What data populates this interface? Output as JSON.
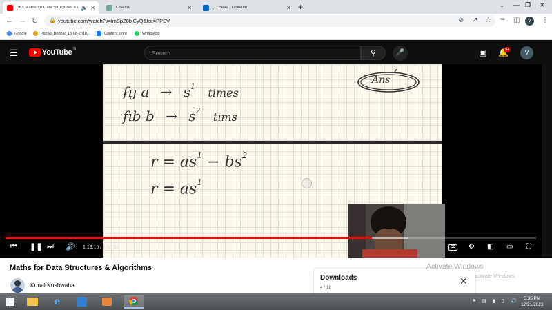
{
  "browser": {
    "tabs": [
      {
        "title": "(90) Maths for Data Structures & Algor",
        "favicon": "youtube-icon",
        "active": true
      },
      {
        "title": "ChatGPT",
        "favicon": "chatgpt-icon",
        "active": false
      },
      {
        "title": "(1) Feed | LinkedIn",
        "favicon": "linkedin-icon",
        "active": false
      }
    ],
    "url": "youtube.com/watch?v=lmSpZ0bjCyQ&list=PPSV",
    "bookmarks": [
      {
        "label": "Google",
        "icon": "google-icon"
      },
      {
        "label": "Patrika Bhopal, 13-08-2018...",
        "icon": "patrika-icon"
      },
      {
        "label": "Content store",
        "icon": "store-icon"
      },
      {
        "label": "WhatsApp",
        "icon": "whatsapp-icon"
      }
    ],
    "profile_initial": "V"
  },
  "youtube": {
    "logo_text": "YouTube",
    "country_code": "IN",
    "search_placeholder": "Search",
    "notification_count": "9+",
    "avatar_initial": "V"
  },
  "player": {
    "board_top": {
      "line1": {
        "lhs": "fıȷ a",
        "arrow": "→",
        "rhs": "s",
        "exp": "1",
        "suffix": "times"
      },
      "line2": {
        "lhs": "fıb b",
        "arrow": "→",
        "rhs": "s",
        "exp": "2",
        "suffix": "tıms"
      },
      "corner_note": "Ans"
    },
    "board_bottom": {
      "line1": {
        "text": "r = as",
        "exp1": "1",
        "mid": " − bs",
        "exp2": "2"
      },
      "line2": {
        "text": "r = as",
        "exp1": "1"
      }
    },
    "time_current": "1:19:15",
    "time_separator": " / ",
    "time_total": "1:54:53",
    "progress_fraction": 0.69,
    "buffered_fraction": 0.76,
    "accent_color": "#ff0000"
  },
  "video": {
    "title": "Maths for Data Structures & Algorithms",
    "channel": "Kunal Kushwaha"
  },
  "downloads_panel": {
    "title": "Downloads",
    "count": "4 / 18"
  },
  "windows_watermark": {
    "line1": "Activate Windows",
    "line2": "Go to PC settings to activate Windows."
  },
  "taskbar": {
    "time": "5:35 PM",
    "date": "12/21/2023"
  }
}
